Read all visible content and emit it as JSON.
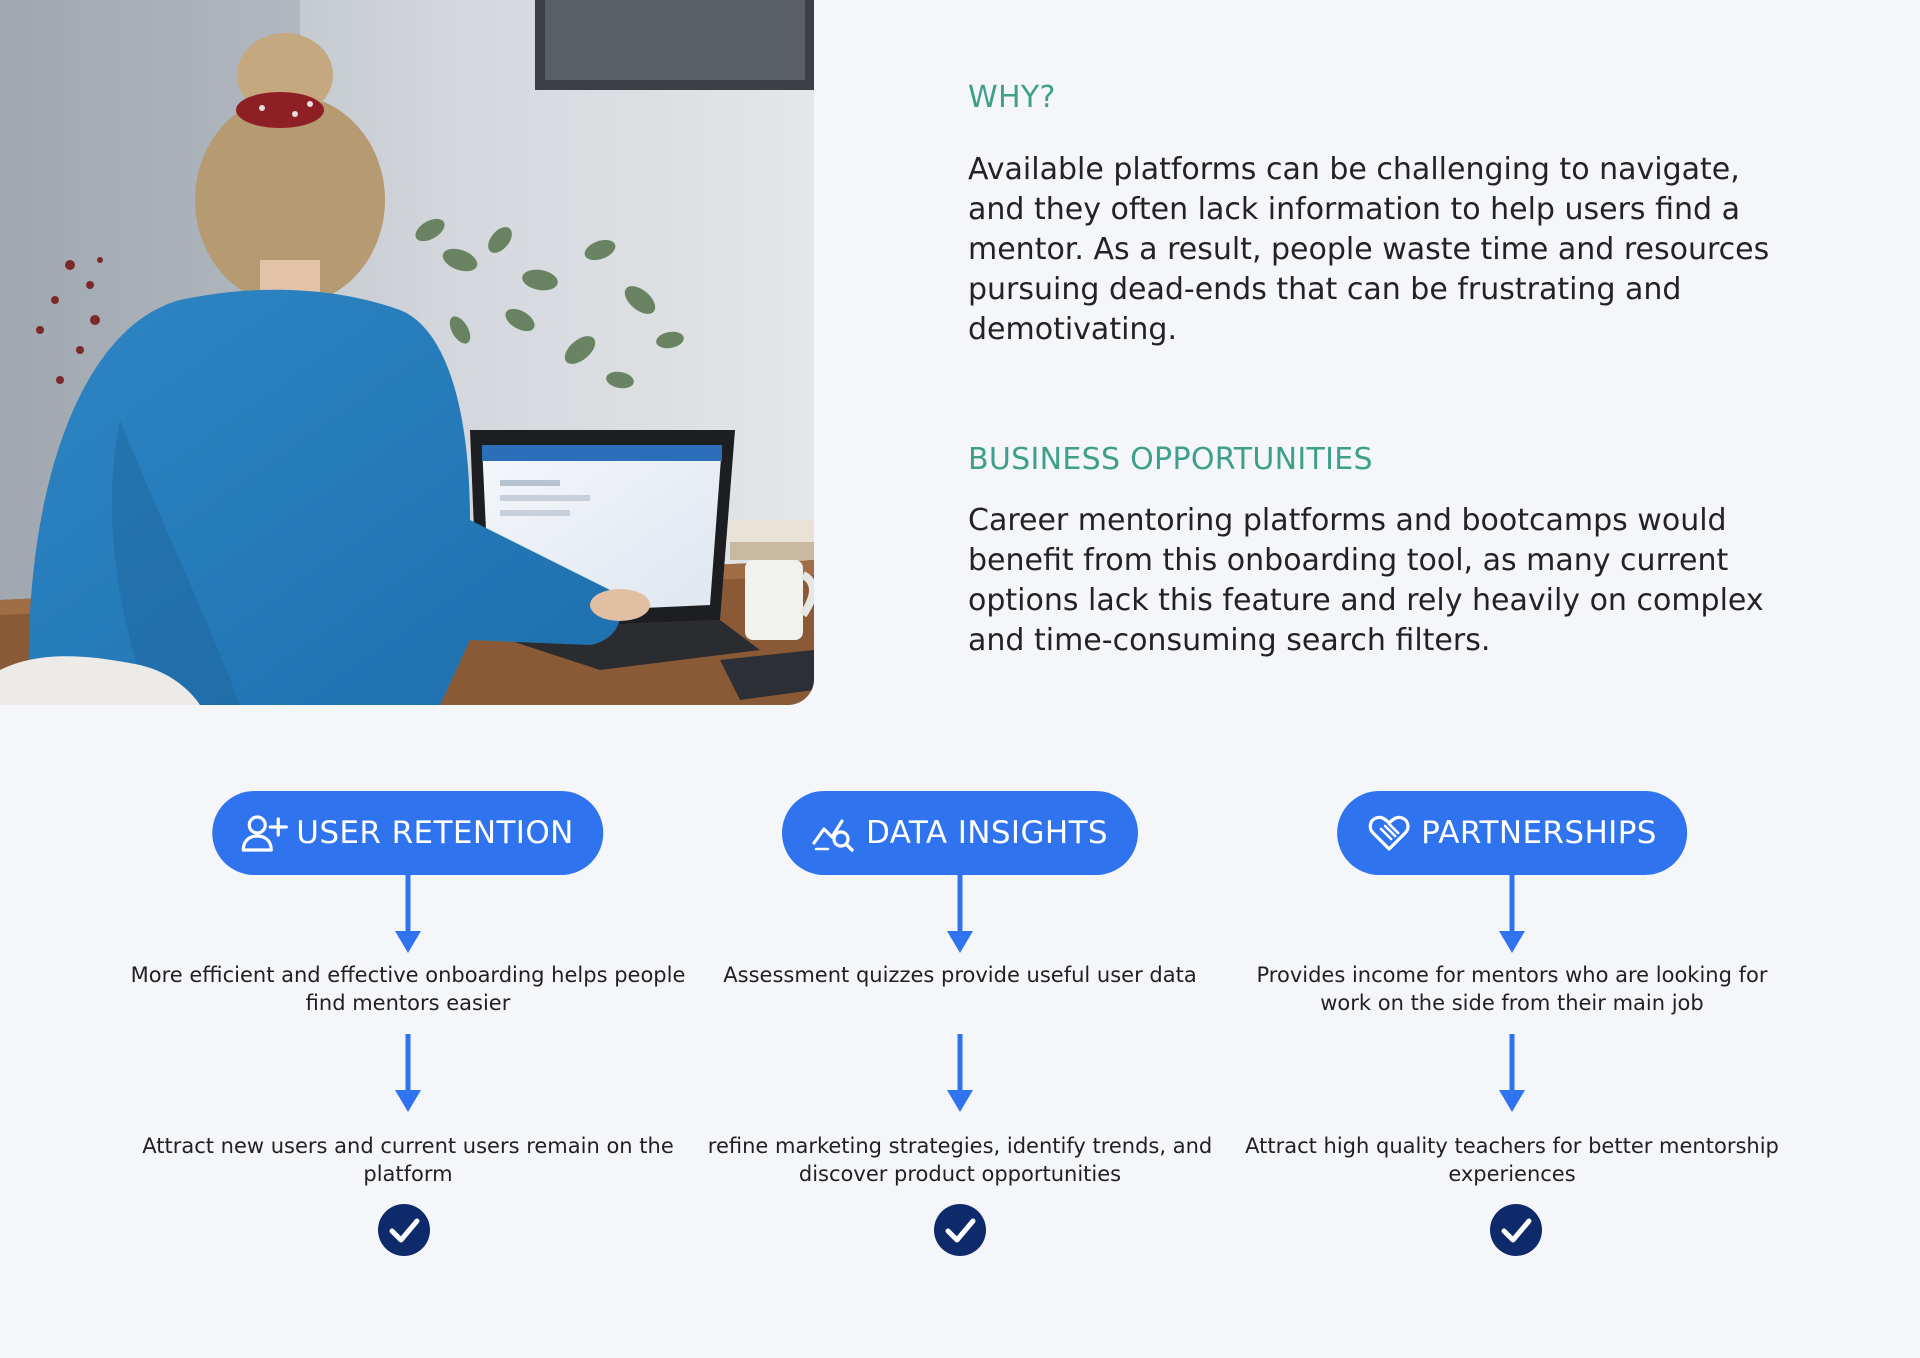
{
  "why": {
    "heading": "WHY?",
    "body": "Available platforms can be challenging to navigate, and they often lack information to help users find a mentor. As a result, people waste time and resources pursuing dead-ends that can be frustrating and demotivating."
  },
  "business": {
    "heading": "BUSINESS OPPORTUNITIES",
    "body": "Career mentoring platforms and bootcamps would benefit from this onboarding tool, as many current options lack this feature and rely heavily on complex and time-consuming search filters."
  },
  "columns": [
    {
      "title": "USER RETENTION",
      "icon": "user-plus-icon",
      "step1": "More efficient and effective onboarding helps people find mentors easier",
      "step2": "Attract new users and current users remain on the platform"
    },
    {
      "title": "DATA INSIGHTS",
      "icon": "chart-search-icon",
      "step1": "Assessment quizzes provide useful user data",
      "step2": "refine marketing strategies, identify trends, and discover product opportunities"
    },
    {
      "title": "PARTNERSHIPS",
      "icon": "handshake-icon",
      "step1": "Provides income for mentors who are looking for work on the side from their main job",
      "step2": "Attract high quality teachers for better mentorship experiences"
    }
  ],
  "colors": {
    "accent_heading": "#3ea08a",
    "pill_blue": "#2f73ee",
    "check_navy": "#0f2a6b",
    "background": "#f5f6f9"
  },
  "photo": {
    "icon": "woman-at-laptop-photo"
  }
}
